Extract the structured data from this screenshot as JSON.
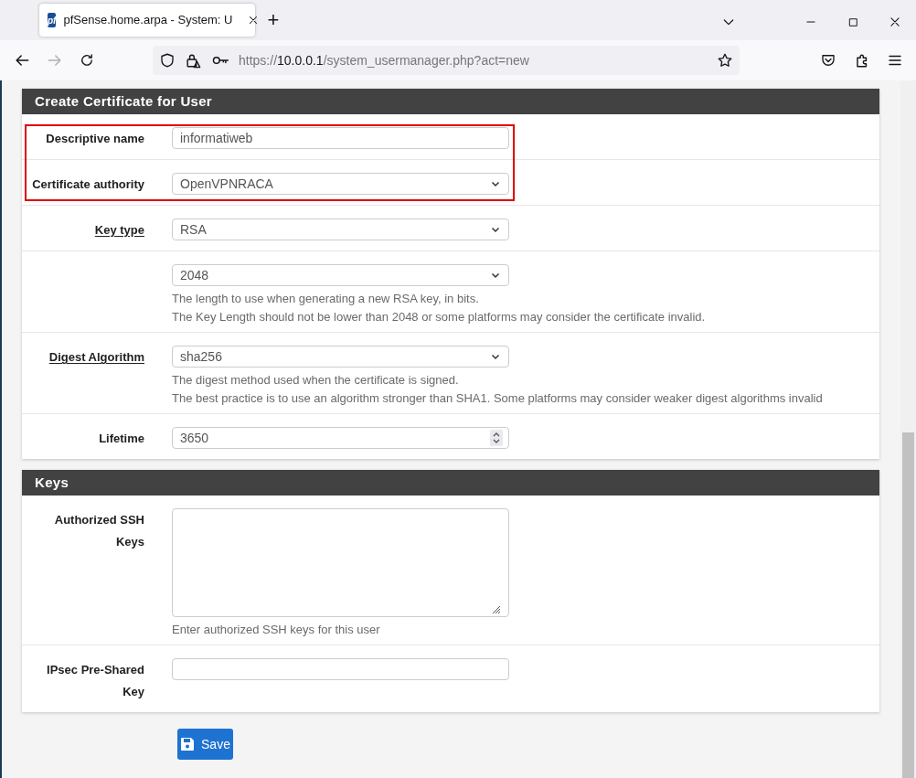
{
  "browser": {
    "tab": {
      "favicon": "pf",
      "title": "pfSense.home.arpa - System: U"
    },
    "new_tab": "+",
    "forward_disabled": true,
    "url": {
      "scheme": "https://",
      "host": "10.0.0.1",
      "path": "/system_usermanager.php?act=new"
    }
  },
  "sections": [
    {
      "title": "Create Certificate for User",
      "rows": [
        {
          "label": "Descriptive name",
          "linked": false,
          "highlighted": true,
          "field": {
            "kind": "text",
            "value": "informatiweb"
          }
        },
        {
          "label": "Certificate authority",
          "linked": false,
          "highlighted": true,
          "field": {
            "kind": "select",
            "value": "OpenVPNRACA"
          }
        },
        {
          "label": "Key type",
          "linked": true,
          "highlighted": false,
          "field": {
            "kind": "select",
            "value": "RSA"
          }
        },
        {
          "highlighted": false,
          "field": {
            "kind": "select",
            "value": "2048"
          },
          "help": [
            "The length to use when generating a new RSA key, in bits.",
            "The Key Length should not be lower than 2048 or some platforms may consider the certificate invalid."
          ]
        },
        {
          "label": "Digest Algorithm",
          "linked": true,
          "highlighted": false,
          "field": {
            "kind": "select",
            "value": "sha256"
          },
          "help": [
            "The digest method used when the certificate is signed.",
            "The best practice is to use an algorithm stronger than SHA1. Some platforms may consider weaker digest algorithms invalid"
          ]
        },
        {
          "label": "Lifetime",
          "linked": false,
          "highlighted": false,
          "field": {
            "kind": "number",
            "value": "3650"
          }
        }
      ]
    },
    {
      "title": "Keys",
      "rows": [
        {
          "label": "Authorized SSH Keys",
          "linked": false,
          "highlighted": false,
          "field": {
            "kind": "textarea"
          },
          "help": [
            "Enter authorized SSH keys for this user"
          ]
        },
        {
          "label": "IPsec Pre-Shared Key",
          "linked": false,
          "highlighted": false,
          "field": {
            "kind": "text"
          }
        }
      ]
    }
  ],
  "save_button": "Save"
}
